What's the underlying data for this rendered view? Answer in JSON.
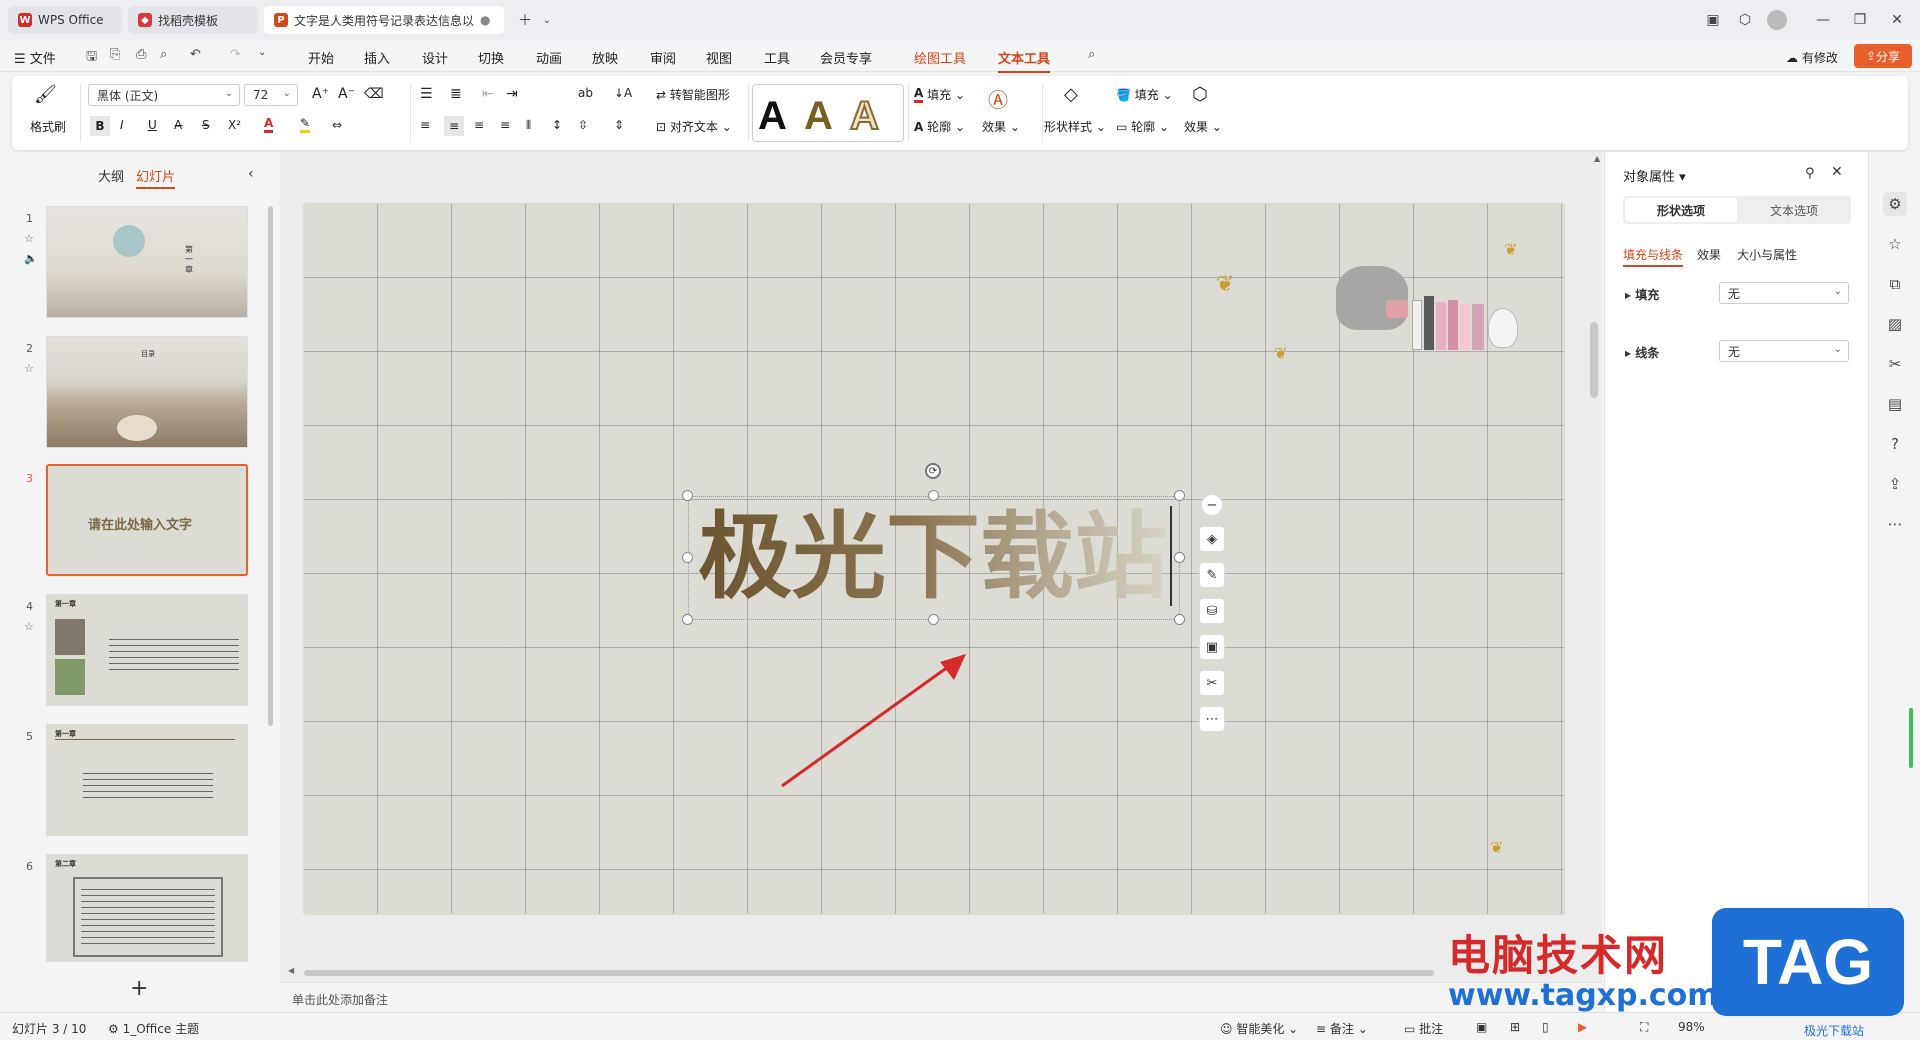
{
  "tabs": [
    {
      "label": "WPS Office"
    },
    {
      "label": "找稻壳模板"
    },
    {
      "label": "文字是人类用符号记录表达信息以"
    }
  ],
  "menu": {
    "file": "文件",
    "items": [
      "开始",
      "插入",
      "设计",
      "切换",
      "动画",
      "放映",
      "审阅",
      "视图",
      "工具",
      "会员专享"
    ],
    "drawing_tools": "绘图工具",
    "text_tools": "文本工具",
    "modified": "有修改",
    "share": "分享"
  },
  "ribbon": {
    "format_painter": "格式刷",
    "font_name": "黑体 (正文)",
    "font_size": "72",
    "smart_shape": "转智能图形",
    "align_text": "对齐文本",
    "style_a": "A",
    "fill": "填充",
    "outline": "轮廓",
    "effect": "效果",
    "shape_style": "形状样式",
    "shape_fill": "填充",
    "shape_outline": "轮廓",
    "shape_effect": "效果"
  },
  "left_panel": {
    "outline_tab": "大纲",
    "slides_tab": "幻灯片",
    "slides": [
      {
        "num": "1",
        "chapter": "第一章"
      },
      {
        "num": "2",
        "title": "目录"
      },
      {
        "num": "3",
        "text": "请在此处输入文字"
      },
      {
        "num": "4",
        "chapter": "第一章"
      },
      {
        "num": "5",
        "chapter": "第一章"
      },
      {
        "num": "6",
        "chapter": "第二章"
      }
    ],
    "add": "+"
  },
  "slide": {
    "text": "极光下载站",
    "colors": {
      "text": "#6b5530",
      "arrow": "#d42a2a"
    }
  },
  "notes_placeholder": "单击此处添加备注",
  "right_panel": {
    "title": "对象属性",
    "tab_shape": "形状选项",
    "tab_text": "文本选项",
    "sub_tabs": [
      "填充与线条",
      "效果",
      "大小与属性"
    ],
    "fill_label": "填充",
    "fill_value": "无",
    "line_label": "线条",
    "line_value": "无"
  },
  "status": {
    "slide_count": "幻灯片 3 / 10",
    "theme": "1_Office 主题",
    "beautify": "智能美化",
    "notes": "备注",
    "comments": "批注",
    "zoom": "98%"
  },
  "watermark": {
    "site_name": "电脑技术网",
    "url": "www.tagxp.com",
    "tag": "TAG",
    "sub": "极光下载站"
  }
}
